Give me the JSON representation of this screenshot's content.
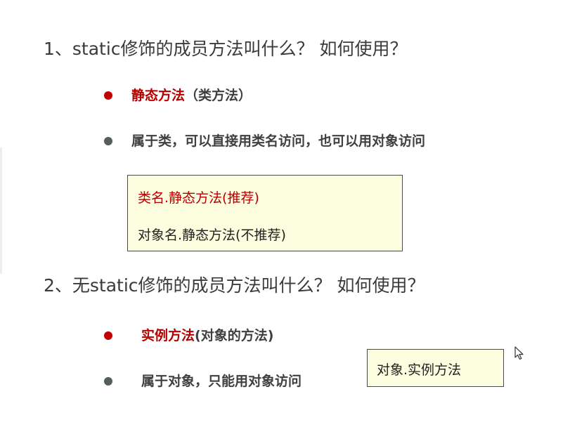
{
  "questions": {
    "q1": "1、static修饰的成员方法叫什么？ 如何使用？",
    "q2": "2、无static修饰的成员方法叫什么？ 如何使用？"
  },
  "section1": {
    "bullet1": {
      "term": "静态方法",
      "paren": "（类方法）"
    },
    "bullet2": "属于类，可以直接用类名访问，也可以用对象访问",
    "box": {
      "line1": "类名.静态方法(推荐)",
      "line2": "对象名.静态方法(不推荐)"
    }
  },
  "section2": {
    "bullet1": {
      "term": "实例方法",
      "paren": "(对象的方法)"
    },
    "bullet2": "属于对象，只能用对象访问",
    "box": "对象.实例方法"
  },
  "colors": {
    "accent_red": "#c00000",
    "box_background": "#fdfde0",
    "bullet_gray": "#555e5c"
  },
  "icons": {
    "cursor": "mouse-pointer-icon"
  }
}
